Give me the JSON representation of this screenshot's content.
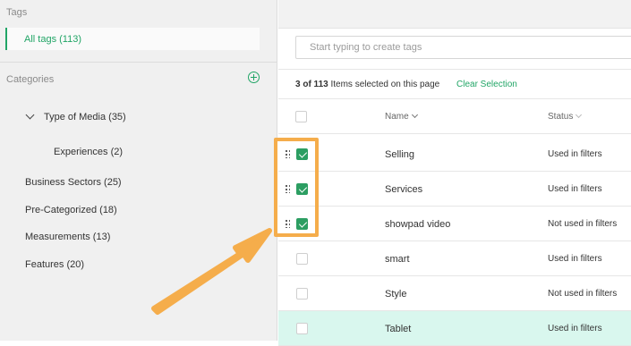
{
  "sidebar": {
    "tags_heading": "Tags",
    "all_tags_label": "All tags (113)",
    "categories_heading": "Categories",
    "add_icon": "plus-circle-icon",
    "categories": {
      "type_of_media": "Type of Media (35)",
      "experiences": "Experiences (2)",
      "business_sectors": "Business Sectors (25)",
      "pre_categorized": "Pre-Categorized (18)",
      "measurements": "Measurements (13)",
      "features": "Features (20)"
    }
  },
  "main": {
    "tag_input_placeholder": "Start typing to create tags",
    "selection": {
      "count": "3 of 113",
      "suffix": " Items selected on this page",
      "clear_label": "Clear Selection"
    },
    "columns": {
      "name": "Name",
      "status": "Status"
    },
    "rows": [
      {
        "name": "Selling",
        "status": "Used in filters",
        "checked": true
      },
      {
        "name": "Services",
        "status": "Used in filters",
        "checked": true
      },
      {
        "name": "showpad video",
        "status": "Not used in filters",
        "checked": true
      },
      {
        "name": "smart",
        "status": "Used in filters",
        "checked": false
      },
      {
        "name": "Style",
        "status": "Not used in filters",
        "checked": false
      },
      {
        "name": "Tablet",
        "status": "Used in filters",
        "checked": false,
        "highlighted": true
      }
    ]
  },
  "colors": {
    "accent": "#21a566",
    "checkbox_checked": "#2c9e62",
    "highlight_row": "#d9f7ee",
    "annotation": "#f5ad4b"
  }
}
